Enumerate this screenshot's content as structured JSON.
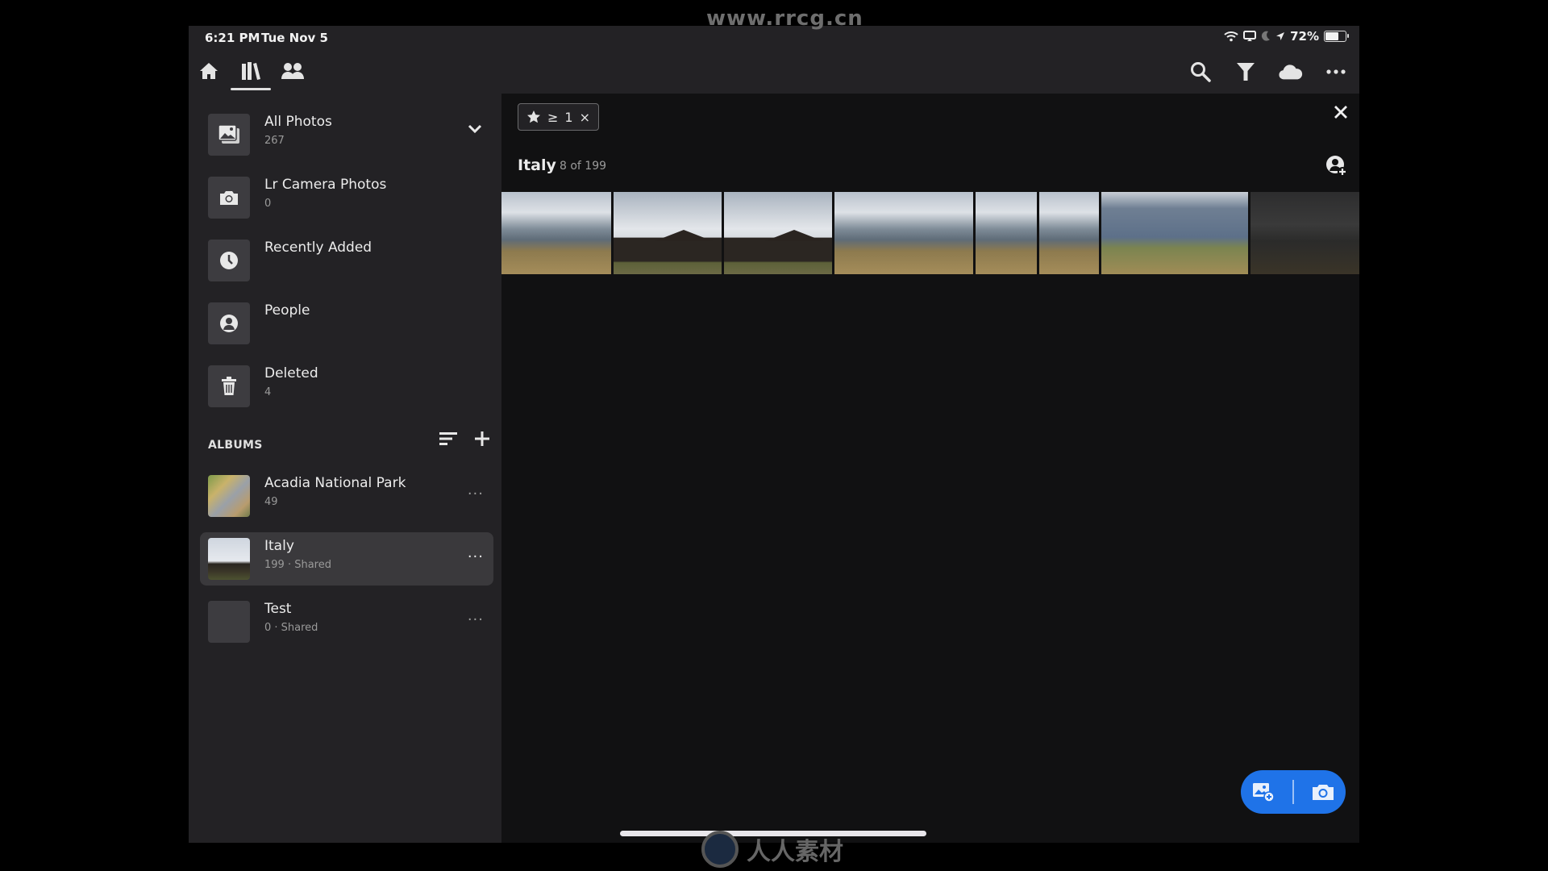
{
  "watermarks": {
    "top": "www.rrcg.cn",
    "bottom": "人人素材"
  },
  "status_bar": {
    "time": "6:21 PM",
    "date": "Tue Nov 5",
    "battery": "72%",
    "battery_level": 0.72
  },
  "nav_tabs": [
    {
      "icon": "home-icon",
      "label": "Home",
      "active": false
    },
    {
      "icon": "library-icon",
      "label": "Library",
      "active": true
    },
    {
      "icon": "people-icon",
      "label": "Shared",
      "active": false
    }
  ],
  "toolbar": {
    "search": "search-icon",
    "filter": "filter-icon",
    "cloud": "cloud-icon",
    "more": "more-icon"
  },
  "sidebar": {
    "items": [
      {
        "name": "All Photos",
        "count": "267",
        "icon": "photos-icon"
      },
      {
        "name": "Lr Camera Photos",
        "count": "0",
        "icon": "camera-icon"
      },
      {
        "name": "Recently Added",
        "count": "",
        "icon": "clock-icon"
      },
      {
        "name": "People",
        "count": "",
        "icon": "person-icon"
      },
      {
        "name": "Deleted",
        "count": "4",
        "icon": "trash-icon"
      }
    ],
    "albums_header": "ALBUMS",
    "albums": [
      {
        "name": "Acadia National Park",
        "sub": "49",
        "selected": false
      },
      {
        "name": "Italy",
        "sub": "199 · Shared",
        "selected": true
      },
      {
        "name": "Test",
        "sub": "0 · Shared",
        "selected": false
      }
    ],
    "more_label": "···"
  },
  "main": {
    "filter_chip": {
      "operator": "≥",
      "value": "1",
      "remove": "×"
    },
    "album_title": "Italy",
    "album_count": "8 of 199",
    "photos": [
      {
        "subject": "mountain-meadow"
      },
      {
        "subject": "cabin"
      },
      {
        "subject": "cabin"
      },
      {
        "subject": "mountain-meadow"
      },
      {
        "subject": "mountain-meadow"
      },
      {
        "subject": "mountain-meadow"
      },
      {
        "subject": "mountain-panorama"
      },
      {
        "subject": "dim-mountain"
      }
    ]
  },
  "fab": {
    "import": "import-photo-icon",
    "camera": "camera-icon"
  }
}
